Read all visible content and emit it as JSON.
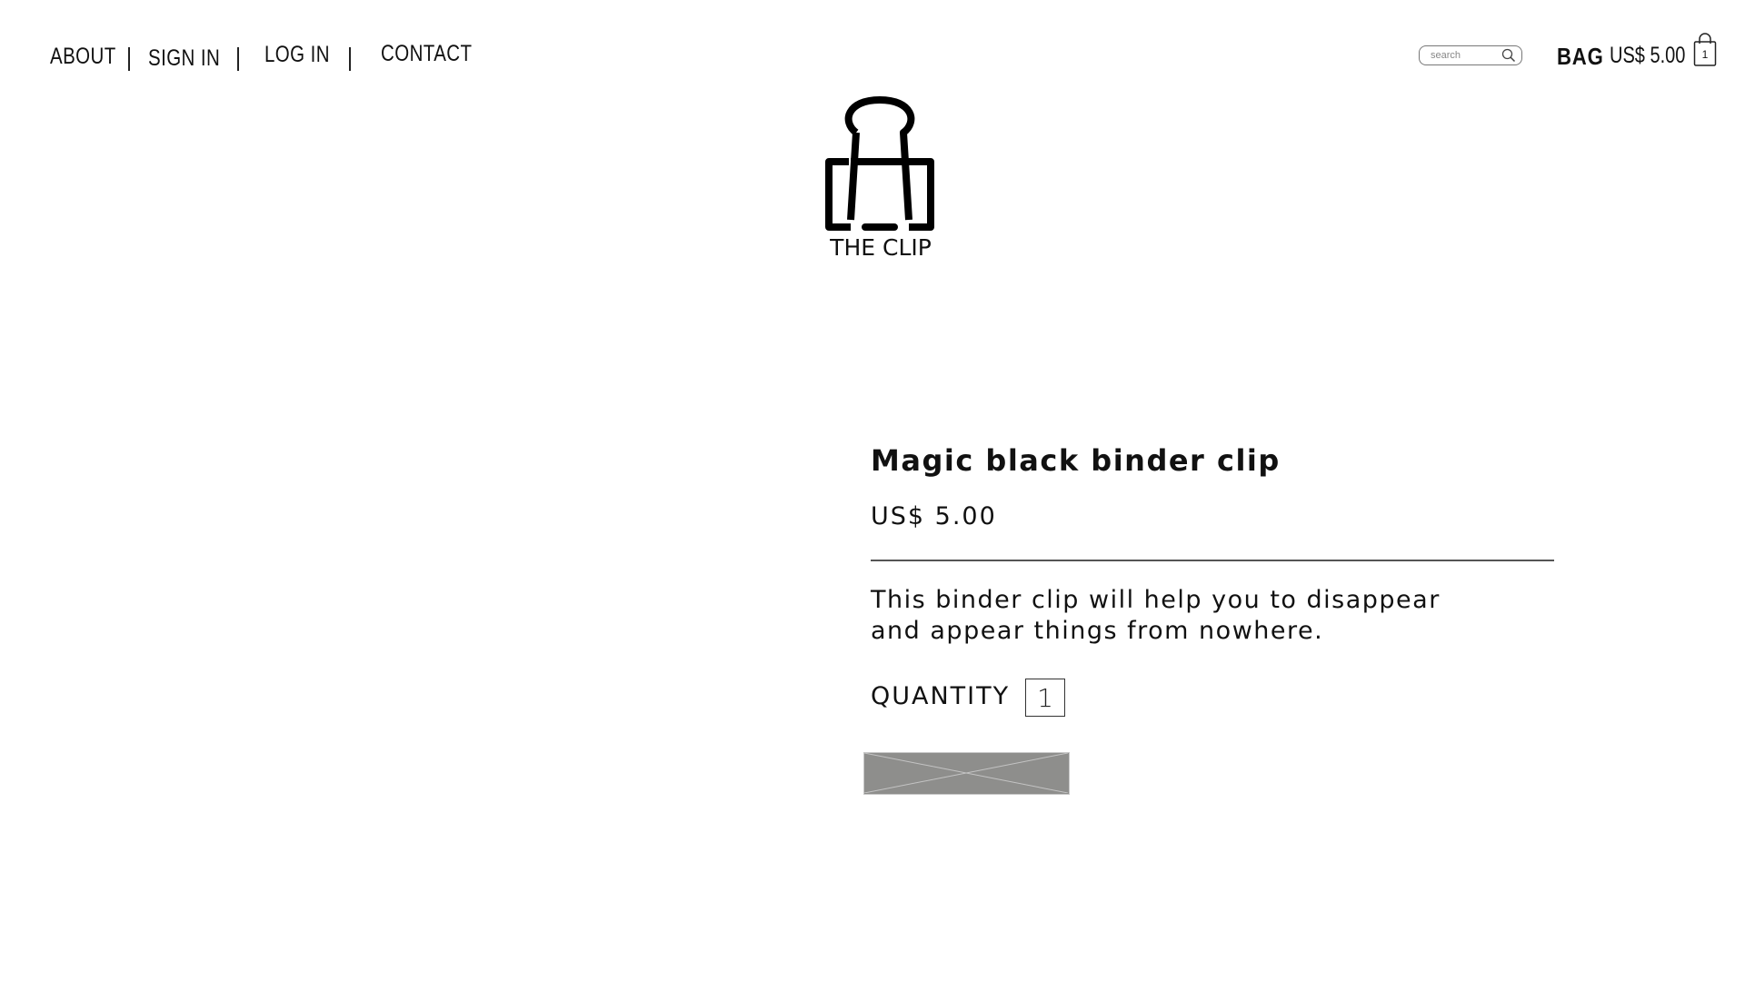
{
  "nav": {
    "items": [
      {
        "label": "ABOUT"
      },
      {
        "label": "SIGN IN"
      },
      {
        "label": "LOG IN"
      },
      {
        "label": "CONTACT"
      }
    ]
  },
  "search": {
    "placeholder": "search",
    "value": ""
  },
  "bag": {
    "label": "BAG",
    "total": "US$ 5.00",
    "count": "1"
  },
  "logo": {
    "text": "THE CLIP"
  },
  "product": {
    "title": "Magic black binder clip",
    "price": "US$ 5.00",
    "description_lines": [
      "This binder clip will help you to disappear",
      "and appear things from nowhere."
    ],
    "quantity_label": "QUANTITY",
    "quantity": "1"
  }
}
